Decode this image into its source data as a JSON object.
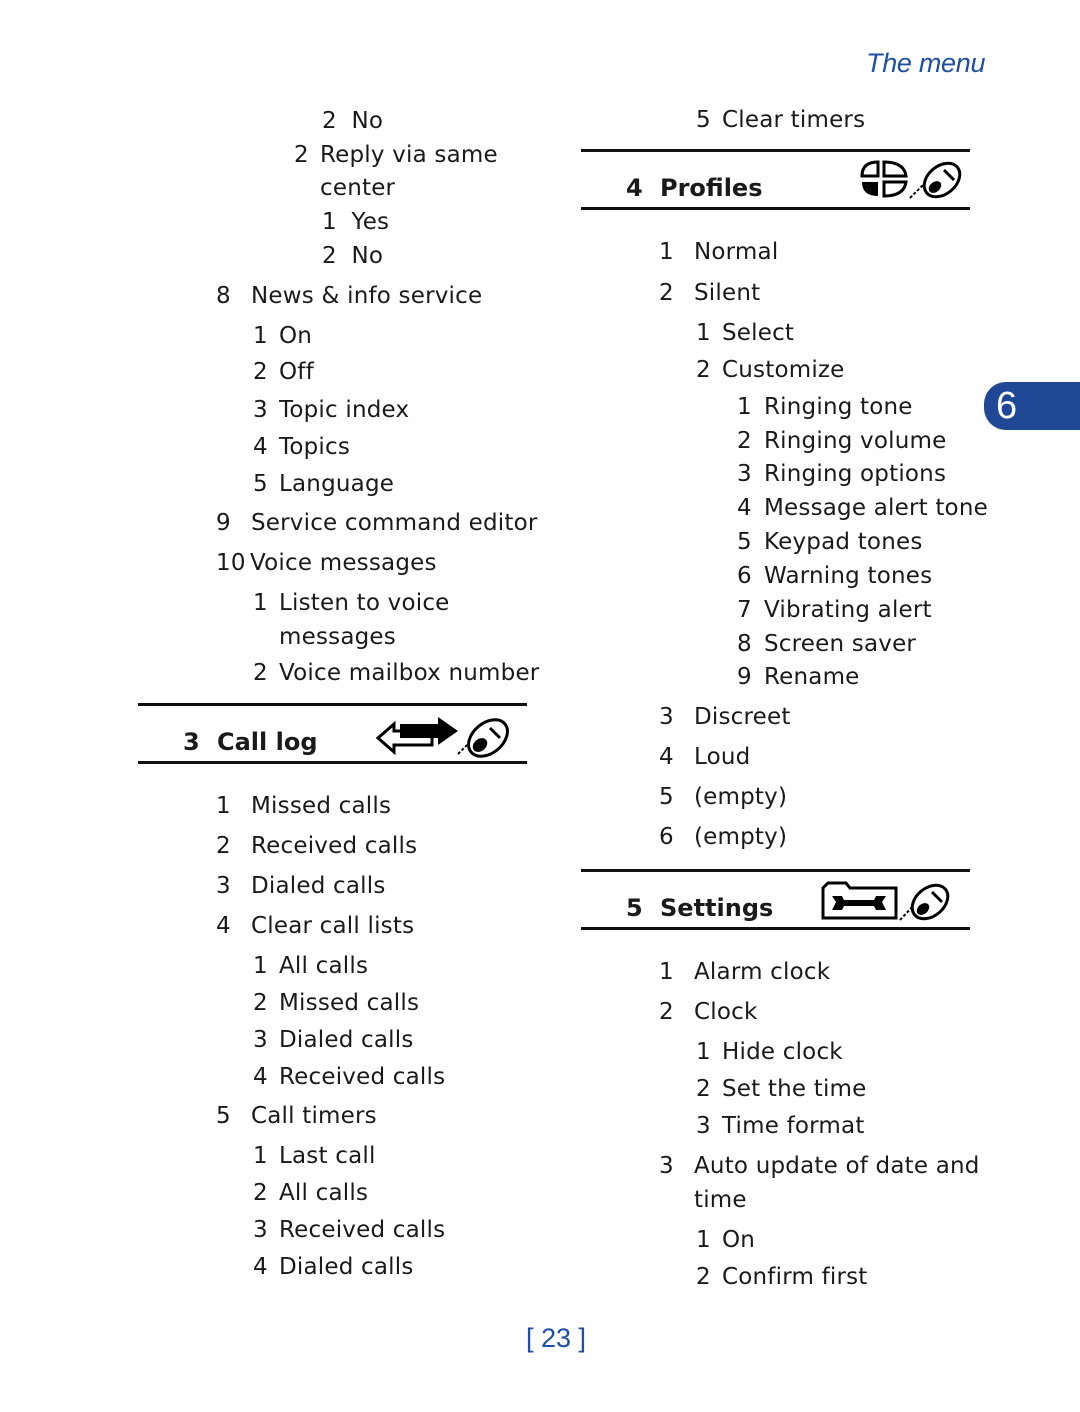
{
  "running_head": "The menu",
  "chapter_tab": "6",
  "page_number": "[ 23 ]",
  "left_column": {
    "lines": [
      {
        "num": "2",
        "text": "No"
      },
      {
        "num": "2",
        "text": "Reply via same"
      },
      {
        "num": "",
        "text": "center"
      },
      {
        "num": "1",
        "text": "Yes"
      },
      {
        "num": "2",
        "text": "No"
      },
      {
        "num": "8",
        "text": "News & info service"
      },
      {
        "num": "1",
        "text": "On"
      },
      {
        "num": "2",
        "text": "Off"
      },
      {
        "num": "3",
        "text": "Topic index"
      },
      {
        "num": "4",
        "text": "Topics"
      },
      {
        "num": "5",
        "text": "Language"
      },
      {
        "num": "9",
        "text": "Service command editor"
      },
      {
        "num": "10",
        "text": "Voice messages"
      },
      {
        "num": "1",
        "text": "Listen to voice"
      },
      {
        "num": "",
        "text": "messages"
      },
      {
        "num": "2",
        "text": "Voice mailbox number"
      }
    ],
    "call_log": {
      "num": "3",
      "title": "Call log",
      "icon": "call-log-icon",
      "lines": [
        {
          "num": "1",
          "text": "Missed calls"
        },
        {
          "num": "2",
          "text": "Received calls"
        },
        {
          "num": "3",
          "text": "Dialed calls"
        },
        {
          "num": "4",
          "text": "Clear call lists"
        },
        {
          "num": "1",
          "text": "All calls"
        },
        {
          "num": "2",
          "text": "Missed calls"
        },
        {
          "num": "3",
          "text": "Dialed calls"
        },
        {
          "num": "4",
          "text": "Received calls"
        },
        {
          "num": "5",
          "text": "Call timers"
        },
        {
          "num": "1",
          "text": "Last call"
        },
        {
          "num": "2",
          "text": "All calls"
        },
        {
          "num": "3",
          "text": "Received calls"
        },
        {
          "num": "4",
          "text": "Dialed calls"
        }
      ]
    }
  },
  "right_column": {
    "top_line": {
      "num": "5",
      "text": "Clear timers"
    },
    "profiles": {
      "num": "4",
      "title": "Profiles",
      "icon": "profiles-icon",
      "lines": [
        {
          "num": "1",
          "text": "Normal"
        },
        {
          "num": "2",
          "text": "Silent"
        },
        {
          "num": "1",
          "text": "Select"
        },
        {
          "num": "2",
          "text": "Customize"
        },
        {
          "num": "1",
          "text": "Ringing tone"
        },
        {
          "num": "2",
          "text": "Ringing volume"
        },
        {
          "num": "3",
          "text": "Ringing options"
        },
        {
          "num": "4",
          "text": "Message alert tone"
        },
        {
          "num": "5",
          "text": "Keypad tones"
        },
        {
          "num": "6",
          "text": "Warning tones"
        },
        {
          "num": "7",
          "text": "Vibrating alert"
        },
        {
          "num": "8",
          "text": "Screen saver"
        },
        {
          "num": "9",
          "text": "Rename"
        },
        {
          "num": "3",
          "text": "Discreet"
        },
        {
          "num": "4",
          "text": "Loud"
        },
        {
          "num": "5",
          "text": "(empty)"
        },
        {
          "num": "6",
          "text": "(empty)"
        }
      ]
    },
    "settings": {
      "num": "5",
      "title": "Settings",
      "icon": "settings-icon",
      "lines": [
        {
          "num": "1",
          "text": "Alarm clock"
        },
        {
          "num": "2",
          "text": "Clock"
        },
        {
          "num": "1",
          "text": "Hide clock"
        },
        {
          "num": "2",
          "text": "Set the time"
        },
        {
          "num": "3",
          "text": "Time format"
        },
        {
          "num": "3",
          "text": "Auto update of date and"
        },
        {
          "num": "",
          "text": "time"
        },
        {
          "num": "1",
          "text": "On"
        },
        {
          "num": "2",
          "text": "Confirm first"
        }
      ]
    }
  }
}
